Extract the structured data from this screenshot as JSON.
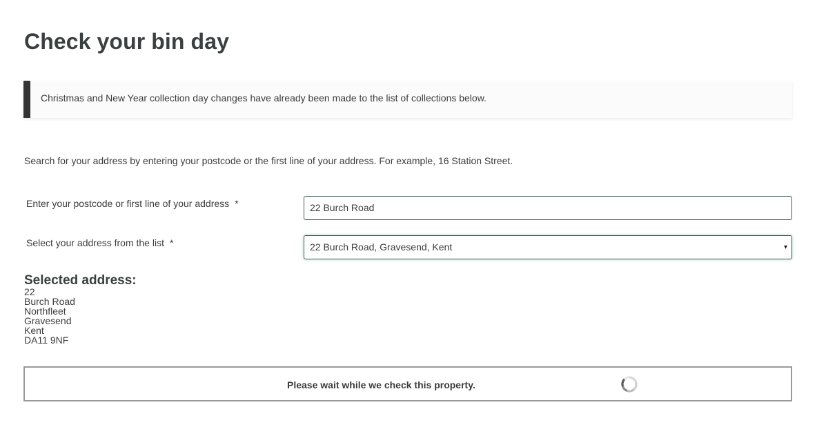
{
  "page": {
    "title": "Check your bin day"
  },
  "notice": {
    "text": "Christmas and New Year collection day changes have already been made to the list of collections below."
  },
  "intro": {
    "text": "Search for your address by entering your postcode or the first line of your address. For example, 16 Station Street."
  },
  "form": {
    "postcode_label": "Enter your postcode or first line of your address",
    "postcode_required": "*",
    "postcode_value": "22 Burch Road",
    "address_label": "Select your address from the list",
    "address_required": "*",
    "address_selected": "22 Burch Road, Gravesend, Kent",
    "address_arrow": "▾"
  },
  "selected_address": {
    "heading": "Selected address:",
    "lines": [
      "22",
      "Burch Road",
      "Northfleet",
      "Gravesend",
      "Kent",
      "DA11 9NF"
    ]
  },
  "status": {
    "text": "Please wait while we check this property.",
    "spinner_icon": "loading-spinner-icon"
  },
  "colors": {
    "text": "#3c3c3c",
    "notice_bar": "#333333",
    "input_border": "#3d5a55",
    "box_border": "#9a9a9a"
  }
}
